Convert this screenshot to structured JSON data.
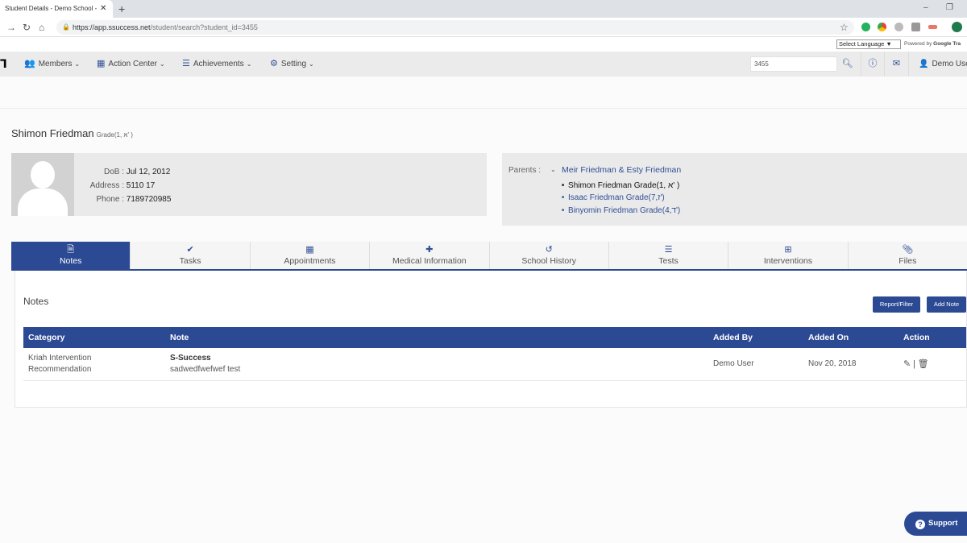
{
  "browser": {
    "tab_title": "Student Details - Demo School - ",
    "tab_close": "✕",
    "new_tab": "+",
    "url_host": "https://app.ssuccess.net",
    "url_path": "/student/search?student_id=3455"
  },
  "translate": {
    "select_language": "Select Language ▼",
    "powered_by": "Powered by",
    "google": "Google",
    "translate": "Tra"
  },
  "nav": {
    "members": "Members",
    "action_center": "Action Center",
    "achievements": "Achievements",
    "setting": "Setting",
    "search_value": "3455",
    "user": "Demo User"
  },
  "student": {
    "name": "Shimon Friedman",
    "grade": "Grade(1, א' )",
    "dob_label": "DoB :",
    "dob": "Jul 12, 2012",
    "address_label": "Address :",
    "address": "5110 17",
    "phone_label": "Phone :",
    "phone": "7189720985"
  },
  "parents": {
    "label": "Parents :",
    "names": "Meir Friedman & Esty Friedman",
    "children": [
      "Shimon Friedman Grade(1, א' )",
      "Isaac Friedman Grade(7,ז')",
      "Binyomin Friedman Grade(4,ד')"
    ]
  },
  "tabs": [
    {
      "label": "Notes",
      "icon": "file-icon"
    },
    {
      "label": "Tasks",
      "icon": "check-icon"
    },
    {
      "label": "Appointments",
      "icon": "calendar-icon"
    },
    {
      "label": "Medical Information",
      "icon": "medkit-icon"
    },
    {
      "label": "School History",
      "icon": "history-icon"
    },
    {
      "label": "Tests",
      "icon": "list-icon"
    },
    {
      "label": "Interventions",
      "icon": "grid-icon"
    },
    {
      "label": "Files",
      "icon": "paperclip-icon"
    }
  ],
  "notes": {
    "title": "Notes",
    "report_filter": "Report/Filter",
    "add_note": "Add Note",
    "columns": [
      "Category",
      "Note",
      "Added By",
      "Added On",
      "Action"
    ],
    "rows": [
      {
        "category_line1": "Kriah Intervention",
        "category_line2": "Recommendation",
        "note_title": "S-Success",
        "note_body": "sadwedfwefwef test",
        "added_by": "Demo User",
        "added_on": "Nov 20, 2018",
        "action_sep": "|"
      }
    ]
  },
  "support": "Support",
  "support_q": "?"
}
